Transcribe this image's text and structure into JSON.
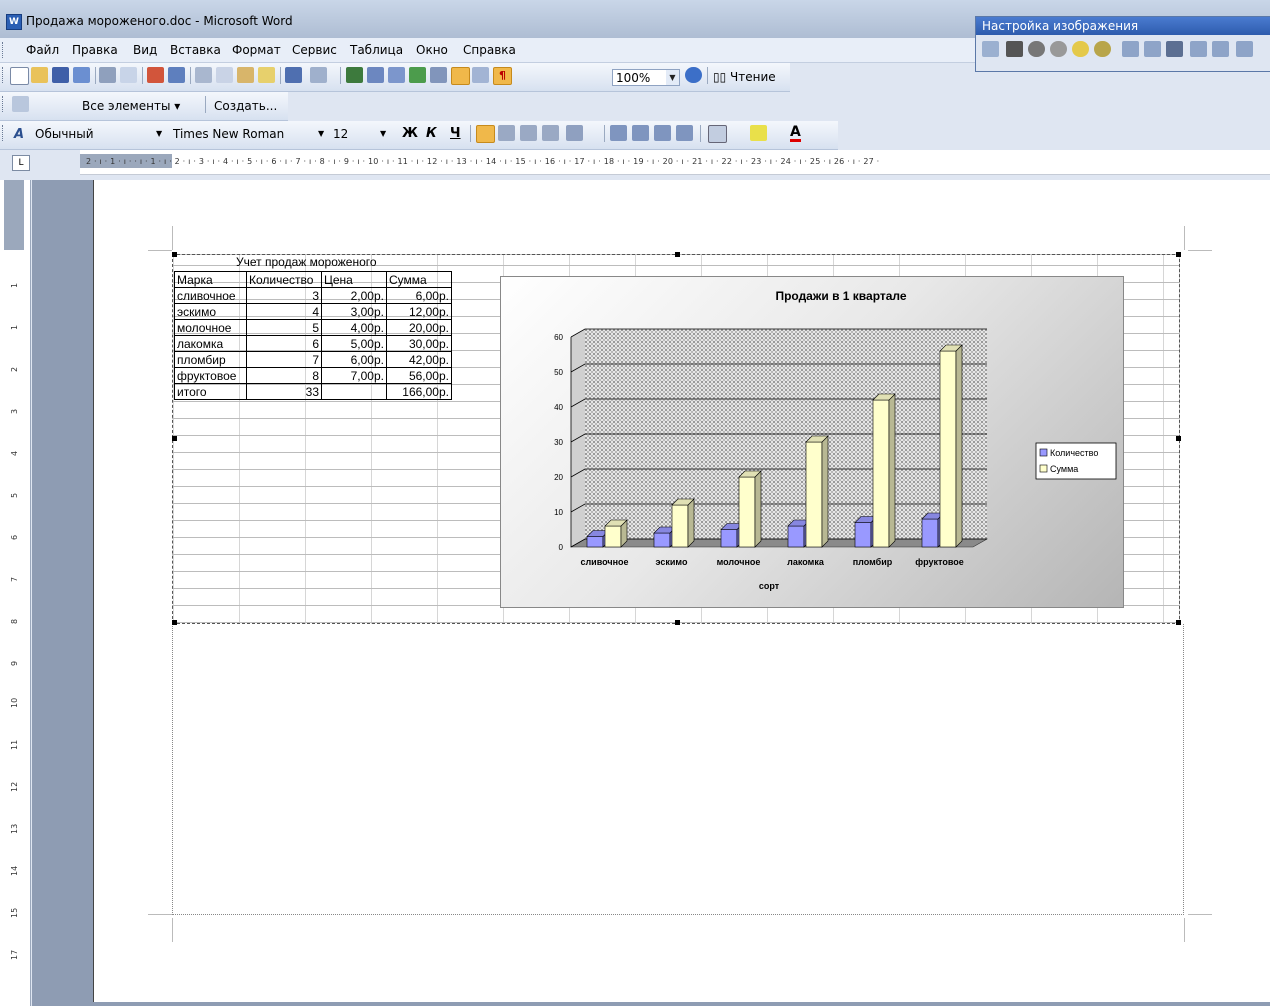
{
  "window": {
    "title": "Продажа мороженого.doc - Microsoft Word",
    "app_icon": "word-doc-icon"
  },
  "menu": [
    {
      "id": "file",
      "label": "Файл"
    },
    {
      "id": "edit",
      "label": "Правка"
    },
    {
      "id": "view",
      "label": "Вид"
    },
    {
      "id": "insert",
      "label": "Вставка"
    },
    {
      "id": "format",
      "label": "Формат"
    },
    {
      "id": "tools",
      "label": "Сервис"
    },
    {
      "id": "table",
      "label": "Таблица"
    },
    {
      "id": "window",
      "label": "Окно"
    },
    {
      "id": "help",
      "label": "Справка"
    }
  ],
  "standard_toolbar": {
    "zoom": "100%",
    "reading_label": "Чтение"
  },
  "outline_toolbar": {
    "all_elements_label": "Все элементы",
    "create_label": "Создать..."
  },
  "formatting_toolbar": {
    "style": "Обычный",
    "font": "Times New Roman",
    "size": "12",
    "bold": "Ж",
    "italic": "К",
    "underline": "Ч"
  },
  "picture_toolbar": {
    "title": "Настройка изображения"
  },
  "ruler": {
    "horizontal_marks": "2 · ı · 1 · ı ·    · ı · 1 · ı · 2 · ı · 3 · ı · 4 · ı · 5 · ı · 6 · ı · 7 · ı · 8 · ı · 9 · ı · 10 · ı · 11 · ı · 12 · ı · 13 · ı · 14 · ı · 15 · ı · 16 · ı · 17 · ı · 18 · ı · 19 · ı · 20 · ı · 21 · ı · 22 · ı · 23 · ı · 24 · ı · 25 · ı 26 · ı · 27 ·",
    "vertical_marks": [
      "1",
      "1",
      "2",
      "3",
      "4",
      "5",
      "6",
      "7",
      "8",
      "9",
      "10",
      "11",
      "12",
      "13",
      "14",
      "15",
      "17"
    ],
    "tab_selector": "L"
  },
  "sheet": {
    "title": "Учет продаж мороженого",
    "headers": [
      "Марка",
      "Количество",
      "Цена",
      "Сумма"
    ],
    "rows": [
      [
        "сливочное",
        "3",
        "2,00р.",
        "6,00р."
      ],
      [
        "эскимо",
        "4",
        "3,00р.",
        "12,00р."
      ],
      [
        "молочное",
        "5",
        "4,00р.",
        "20,00р."
      ],
      [
        "лакомка",
        "6",
        "5,00р.",
        "30,00р."
      ],
      [
        "пломбир",
        "7",
        "6,00р.",
        "42,00р."
      ],
      [
        "фруктовое",
        "8",
        "7,00р.",
        "56,00р."
      ],
      [
        "итого",
        "33",
        "",
        "166,00р."
      ]
    ]
  },
  "chart_data": {
    "type": "bar",
    "title": "Продажи в 1 квартале",
    "xlabel": "сорт",
    "ylabel": "",
    "categories": [
      "сливочное",
      "эскимо",
      "молочное",
      "лакомка",
      "пломбир",
      "фруктовое"
    ],
    "series": [
      {
        "name": "Количество",
        "values": [
          3,
          4,
          5,
          6,
          7,
          8
        ],
        "color": "#9999ff"
      },
      {
        "name": "Сумма",
        "values": [
          6,
          12,
          20,
          30,
          42,
          56
        ],
        "color": "#ffffcc"
      }
    ],
    "ylim": [
      0,
      60
    ],
    "yticks": [
      0,
      10,
      20,
      30,
      40,
      50,
      60
    ],
    "grid": true,
    "legend": "right"
  }
}
